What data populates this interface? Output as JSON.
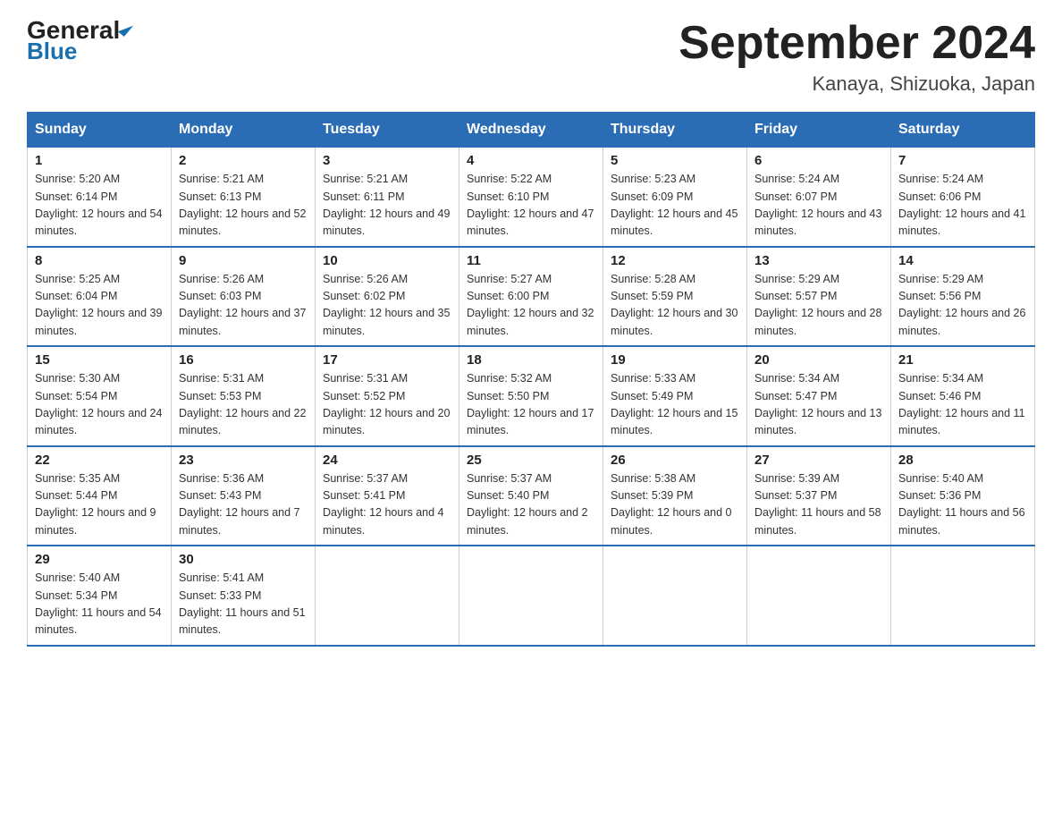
{
  "header": {
    "logo_general": "General",
    "logo_blue": "Blue",
    "title": "September 2024",
    "subtitle": "Kanaya, Shizuoka, Japan"
  },
  "days_of_week": [
    "Sunday",
    "Monday",
    "Tuesday",
    "Wednesday",
    "Thursday",
    "Friday",
    "Saturday"
  ],
  "weeks": [
    [
      {
        "day": "1",
        "sunrise": "5:20 AM",
        "sunset": "6:14 PM",
        "daylight": "12 hours and 54 minutes."
      },
      {
        "day": "2",
        "sunrise": "5:21 AM",
        "sunset": "6:13 PM",
        "daylight": "12 hours and 52 minutes."
      },
      {
        "day": "3",
        "sunrise": "5:21 AM",
        "sunset": "6:11 PM",
        "daylight": "12 hours and 49 minutes."
      },
      {
        "day": "4",
        "sunrise": "5:22 AM",
        "sunset": "6:10 PM",
        "daylight": "12 hours and 47 minutes."
      },
      {
        "day": "5",
        "sunrise": "5:23 AM",
        "sunset": "6:09 PM",
        "daylight": "12 hours and 45 minutes."
      },
      {
        "day": "6",
        "sunrise": "5:24 AM",
        "sunset": "6:07 PM",
        "daylight": "12 hours and 43 minutes."
      },
      {
        "day": "7",
        "sunrise": "5:24 AM",
        "sunset": "6:06 PM",
        "daylight": "12 hours and 41 minutes."
      }
    ],
    [
      {
        "day": "8",
        "sunrise": "5:25 AM",
        "sunset": "6:04 PM",
        "daylight": "12 hours and 39 minutes."
      },
      {
        "day": "9",
        "sunrise": "5:26 AM",
        "sunset": "6:03 PM",
        "daylight": "12 hours and 37 minutes."
      },
      {
        "day": "10",
        "sunrise": "5:26 AM",
        "sunset": "6:02 PM",
        "daylight": "12 hours and 35 minutes."
      },
      {
        "day": "11",
        "sunrise": "5:27 AM",
        "sunset": "6:00 PM",
        "daylight": "12 hours and 32 minutes."
      },
      {
        "day": "12",
        "sunrise": "5:28 AM",
        "sunset": "5:59 PM",
        "daylight": "12 hours and 30 minutes."
      },
      {
        "day": "13",
        "sunrise": "5:29 AM",
        "sunset": "5:57 PM",
        "daylight": "12 hours and 28 minutes."
      },
      {
        "day": "14",
        "sunrise": "5:29 AM",
        "sunset": "5:56 PM",
        "daylight": "12 hours and 26 minutes."
      }
    ],
    [
      {
        "day": "15",
        "sunrise": "5:30 AM",
        "sunset": "5:54 PM",
        "daylight": "12 hours and 24 minutes."
      },
      {
        "day": "16",
        "sunrise": "5:31 AM",
        "sunset": "5:53 PM",
        "daylight": "12 hours and 22 minutes."
      },
      {
        "day": "17",
        "sunrise": "5:31 AM",
        "sunset": "5:52 PM",
        "daylight": "12 hours and 20 minutes."
      },
      {
        "day": "18",
        "sunrise": "5:32 AM",
        "sunset": "5:50 PM",
        "daylight": "12 hours and 17 minutes."
      },
      {
        "day": "19",
        "sunrise": "5:33 AM",
        "sunset": "5:49 PM",
        "daylight": "12 hours and 15 minutes."
      },
      {
        "day": "20",
        "sunrise": "5:34 AM",
        "sunset": "5:47 PM",
        "daylight": "12 hours and 13 minutes."
      },
      {
        "day": "21",
        "sunrise": "5:34 AM",
        "sunset": "5:46 PM",
        "daylight": "12 hours and 11 minutes."
      }
    ],
    [
      {
        "day": "22",
        "sunrise": "5:35 AM",
        "sunset": "5:44 PM",
        "daylight": "12 hours and 9 minutes."
      },
      {
        "day": "23",
        "sunrise": "5:36 AM",
        "sunset": "5:43 PM",
        "daylight": "12 hours and 7 minutes."
      },
      {
        "day": "24",
        "sunrise": "5:37 AM",
        "sunset": "5:41 PM",
        "daylight": "12 hours and 4 minutes."
      },
      {
        "day": "25",
        "sunrise": "5:37 AM",
        "sunset": "5:40 PM",
        "daylight": "12 hours and 2 minutes."
      },
      {
        "day": "26",
        "sunrise": "5:38 AM",
        "sunset": "5:39 PM",
        "daylight": "12 hours and 0 minutes."
      },
      {
        "day": "27",
        "sunrise": "5:39 AM",
        "sunset": "5:37 PM",
        "daylight": "11 hours and 58 minutes."
      },
      {
        "day": "28",
        "sunrise": "5:40 AM",
        "sunset": "5:36 PM",
        "daylight": "11 hours and 56 minutes."
      }
    ],
    [
      {
        "day": "29",
        "sunrise": "5:40 AM",
        "sunset": "5:34 PM",
        "daylight": "11 hours and 54 minutes."
      },
      {
        "day": "30",
        "sunrise": "5:41 AM",
        "sunset": "5:33 PM",
        "daylight": "11 hours and 51 minutes."
      },
      null,
      null,
      null,
      null,
      null
    ]
  ]
}
